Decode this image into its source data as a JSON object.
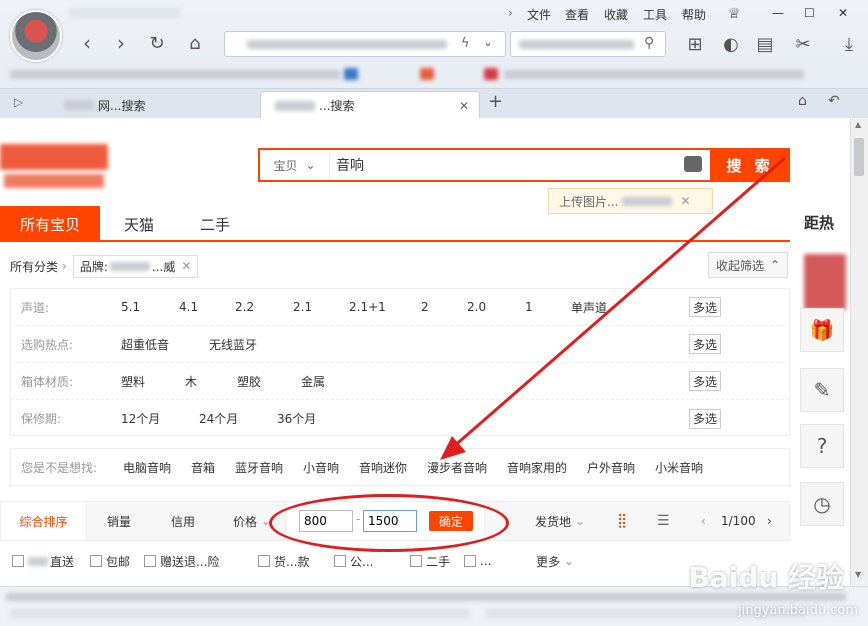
{
  "browser": {
    "menu": [
      "文件",
      "查看",
      "收藏",
      "工具",
      "帮助"
    ],
    "tabs": [
      {
        "label": "网...搜索"
      },
      {
        "label": "...搜索"
      }
    ]
  },
  "search": {
    "category": "宝贝",
    "query": "音响",
    "button": "搜 索",
    "upload_tip": "上传图片..."
  },
  "shop_tabs": [
    "所有宝贝",
    "天猫",
    "二手"
  ],
  "right_hot": "距热",
  "crumb": {
    "all": "所有分类",
    "brand_label": "品牌:",
    "brand_value": "...威"
  },
  "collapse": "收起筛选",
  "filters": [
    {
      "label": "声道:",
      "options": [
        "5.1",
        "4.1",
        "2.2",
        "2.1",
        "2.1+1",
        "2",
        "2.0",
        "1",
        "单声道"
      ],
      "multi": "多选"
    },
    {
      "label": "选购热点:",
      "options": [
        "超重低音",
        "无线蓝牙"
      ],
      "multi": "多选"
    },
    {
      "label": "箱体材质:",
      "options": [
        "塑料",
        "木",
        "塑胶",
        "金属"
      ],
      "multi": "多选"
    },
    {
      "label": "保修期:",
      "options": [
        "12个月",
        "24个月",
        "36个月"
      ],
      "multi": "多选"
    }
  ],
  "suggest": {
    "label": "您是不是想找:",
    "items": [
      "电脑音响",
      "音箱",
      "蓝牙音响",
      "小音响",
      "音响迷你",
      "漫步者音响",
      "音响家用的",
      "户外音响",
      "小米音响"
    ]
  },
  "sort": {
    "items": [
      "综合排序",
      "销量",
      "信用",
      "价格"
    ],
    "price_min": "800",
    "price_max": "1500",
    "dash": "-",
    "ok": "确定",
    "ship": "发货地",
    "page": "1/100"
  },
  "checks": [
    "直送",
    "包邮",
    "赠送退...险",
    "货...款",
    "公...",
    "二手",
    "..."
  ],
  "more": "更多",
  "watermark": {
    "main": "Baidu 经验",
    "sub": "jingyan.baidu.com"
  },
  "colors": {
    "accent": "#ff4400",
    "annotation": "#e21d1d"
  }
}
